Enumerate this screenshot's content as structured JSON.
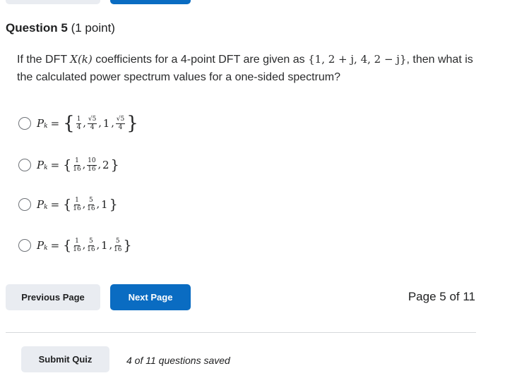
{
  "question": {
    "number": "Question 5",
    "points": "(1 point)",
    "text_before": "If the DFT ",
    "text_symbol": "X(k)",
    "text_mid": " coefficients for a 4-point DFT are given as ",
    "text_set": "{1, 2 + j, 4, 2 − j}",
    "text_after": ", then what is the calculated power spectrum values for a one-sided spectrum?"
  },
  "formula_common": {
    "symbol": "P",
    "subscript": "k",
    "equals": "="
  },
  "options": [
    {
      "terms": [
        {
          "num": "1",
          "den": "4"
        },
        {
          "num": "√5",
          "den": "4"
        },
        {
          "whole": "1"
        },
        {
          "num": "√5",
          "den": "4"
        }
      ]
    },
    {
      "terms": [
        {
          "num": "1",
          "den": "16"
        },
        {
          "num": "10",
          "den": "16"
        },
        {
          "whole": "2"
        }
      ]
    },
    {
      "terms": [
        {
          "num": "1",
          "den": "16"
        },
        {
          "num": "5",
          "den": "16"
        },
        {
          "whole": "1"
        }
      ]
    },
    {
      "terms": [
        {
          "num": "1",
          "den": "16"
        },
        {
          "num": "5",
          "den": "16"
        },
        {
          "whole": "1"
        },
        {
          "num": "5",
          "den": "16"
        }
      ]
    }
  ],
  "nav": {
    "previous_label": "Previous Page",
    "next_label": "Next Page",
    "page_indicator": "Page 5 of 11"
  },
  "footer": {
    "submit_label": "Submit Quiz",
    "saved_status": "4 of 11 questions saved"
  },
  "colors": {
    "primary": "#0a6cc2",
    "secondary_button": "#e9ecf1",
    "text": "#202122",
    "divider": "#d6d8db"
  }
}
